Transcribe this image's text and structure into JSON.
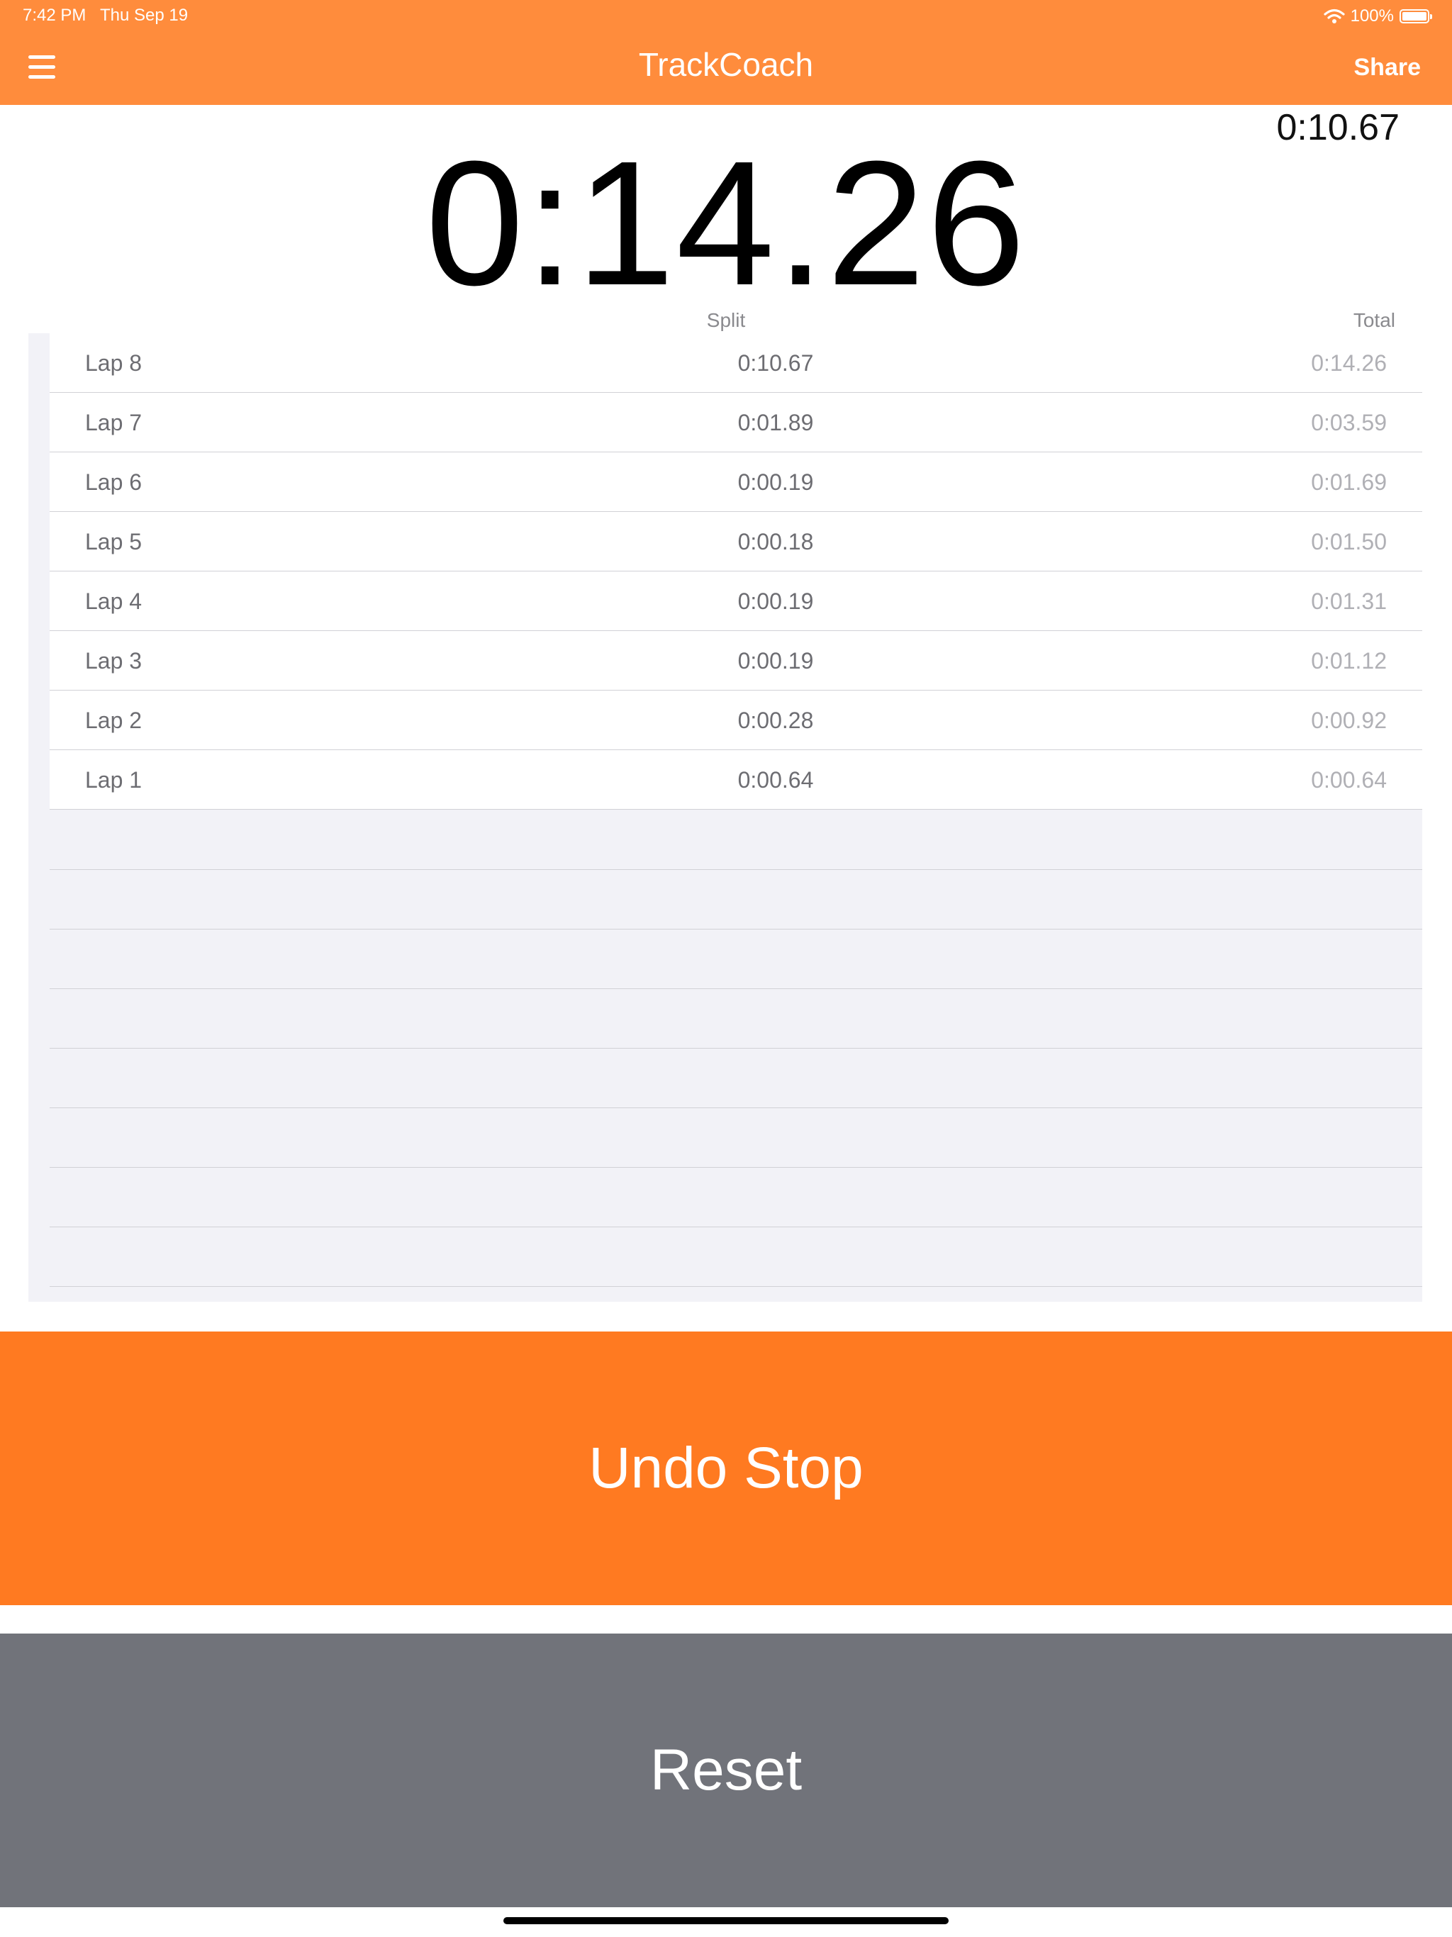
{
  "status_bar": {
    "time": "7:42 PM",
    "date": "Thu Sep 19",
    "battery_percent": "100%",
    "icons": [
      "wifi-icon",
      "battery-icon"
    ]
  },
  "nav": {
    "title": "TrackCoach",
    "share_label": "Share",
    "menu_icon": "hamburger-menu-icon"
  },
  "timer": {
    "main": "0:14.26",
    "current_lap": "0:10.67"
  },
  "table": {
    "split_header": "Split",
    "total_header": "Total",
    "laps": [
      {
        "label": "Lap 8",
        "split": "0:10.67",
        "total": "0:14.26"
      },
      {
        "label": "Lap 7",
        "split": "0:01.89",
        "total": "0:03.59"
      },
      {
        "label": "Lap 6",
        "split": "0:00.19",
        "total": "0:01.69"
      },
      {
        "label": "Lap 5",
        "split": "0:00.18",
        "total": "0:01.50"
      },
      {
        "label": "Lap 4",
        "split": "0:00.19",
        "total": "0:01.31"
      },
      {
        "label": "Lap 3",
        "split": "0:00.19",
        "total": "0:01.12"
      },
      {
        "label": "Lap 2",
        "split": "0:00.28",
        "total": "0:00.92"
      },
      {
        "label": "Lap 1",
        "split": "0:00.64",
        "total": "0:00.64"
      }
    ]
  },
  "buttons": {
    "undo_stop": "Undo Stop",
    "reset": "Reset"
  },
  "colors": {
    "header_orange": "#ff8c3c",
    "button_orange": "#ff7a21",
    "reset_gray": "#71737a"
  }
}
